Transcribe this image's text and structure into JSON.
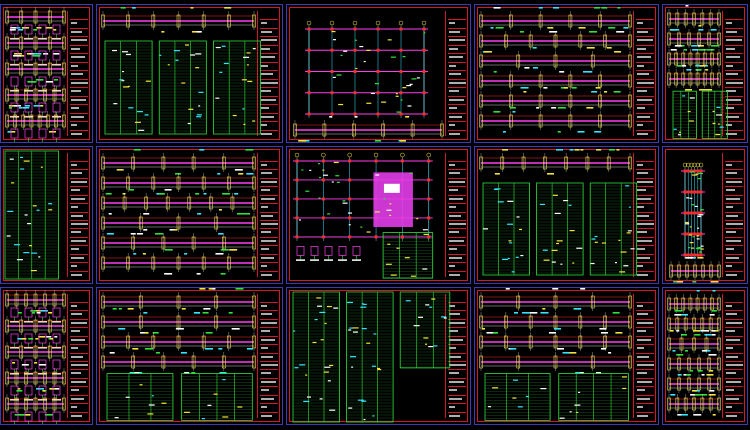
{
  "colors": {
    "background": "#000000",
    "sheet_border": "#3b3bb8",
    "frame": "#d0182c",
    "beam_axis": "#ff3df0",
    "table_grid": "#2fe23a",
    "dimension": "#ffffff",
    "accent_yellow": "#f5e33a",
    "accent_cyan": "#33e6ff",
    "accent_red": "#ff2a2a",
    "magenta_fill": "#e23ce8"
  },
  "sheets": [
    {
      "row": 0,
      "col": 0,
      "kind": "beam-sections"
    },
    {
      "row": 0,
      "col": 1,
      "kind": "rebar-table"
    },
    {
      "row": 0,
      "col": 2,
      "kind": "framing-plan"
    },
    {
      "row": 0,
      "col": 3,
      "kind": "beam-elevations"
    },
    {
      "row": 0,
      "col": 4,
      "kind": "beam-elevations-table"
    },
    {
      "row": 1,
      "col": 0,
      "kind": "tall-table"
    },
    {
      "row": 1,
      "col": 1,
      "kind": "beam-elevations"
    },
    {
      "row": 1,
      "col": 2,
      "kind": "plan-with-slab"
    },
    {
      "row": 1,
      "col": 3,
      "kind": "rebar-table"
    },
    {
      "row": 1,
      "col": 4,
      "kind": "framing-plan"
    },
    {
      "row": 2,
      "col": 0,
      "kind": "beam-sections"
    },
    {
      "row": 2,
      "col": 1,
      "kind": "beam-elevations-table"
    },
    {
      "row": 2,
      "col": 2,
      "kind": "full-table"
    },
    {
      "row": 2,
      "col": 3,
      "kind": "beam-elevations-table"
    },
    {
      "row": 2,
      "col": 4,
      "kind": "beam-elevations"
    }
  ]
}
